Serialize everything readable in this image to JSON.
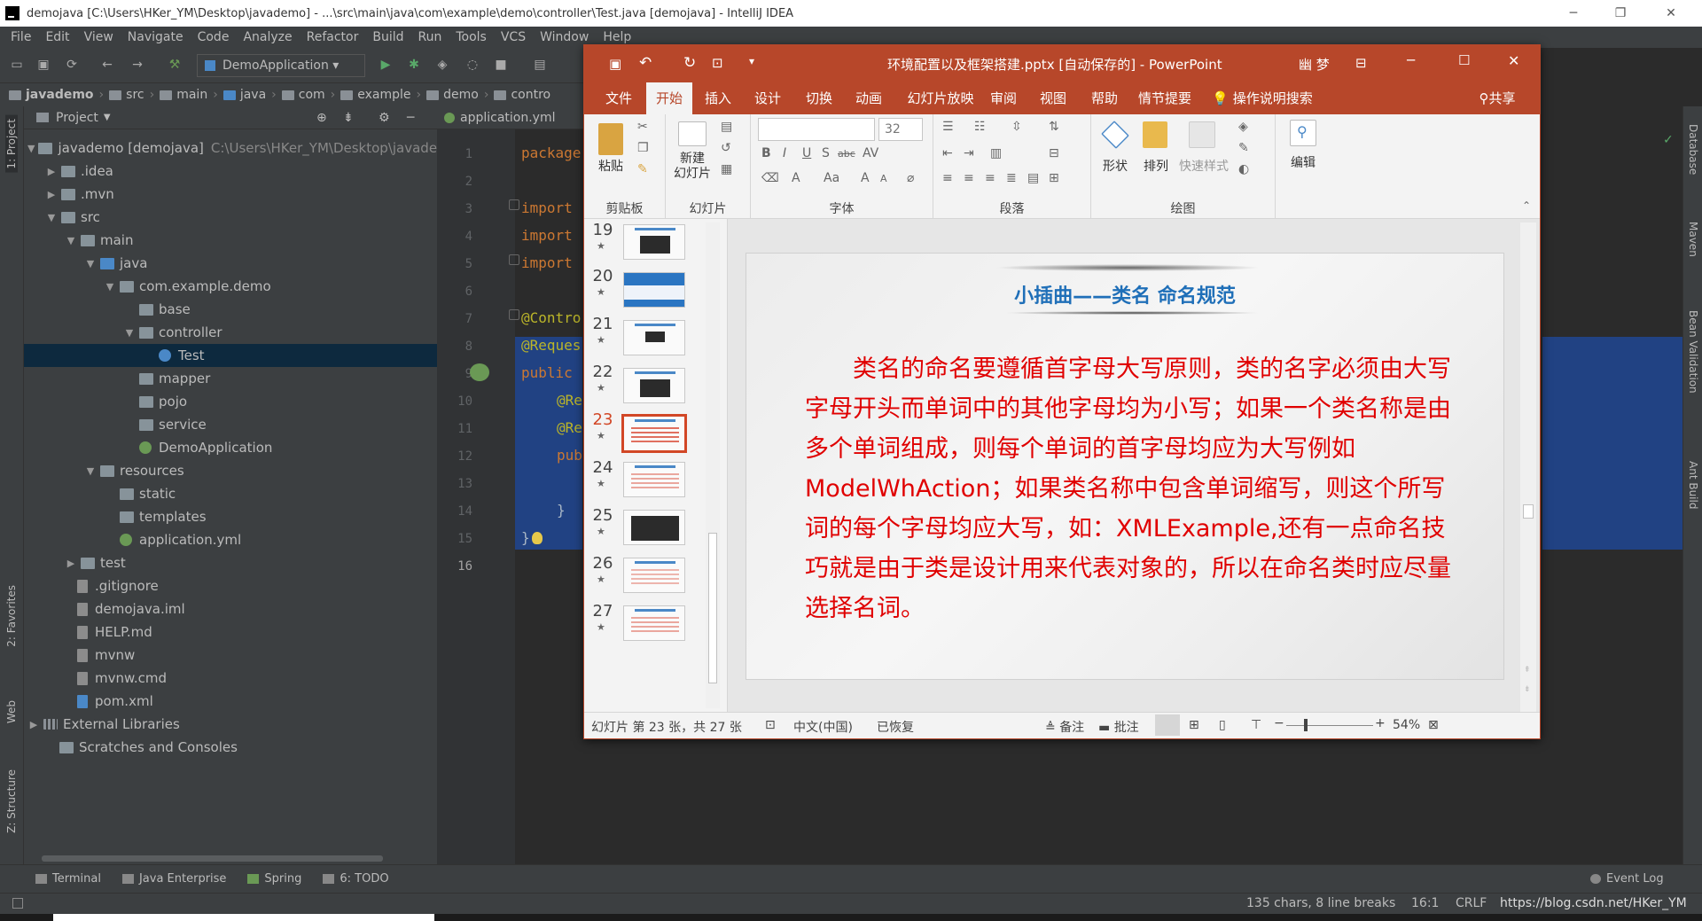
{
  "ide": {
    "title": "demojava [C:\\Users\\HKer_YM\\Desktop\\javademo] - ...\\src\\main\\java\\com\\example\\demo\\controller\\Test.java [demojava] - IntelliJ IDEA",
    "menu": [
      "File",
      "Edit",
      "View",
      "Navigate",
      "Code",
      "Analyze",
      "Refactor",
      "Build",
      "Run",
      "Tools",
      "VCS",
      "Window",
      "Help"
    ],
    "run_config": "DemoApplication",
    "breadcrumbs": [
      "javademo",
      "src",
      "main",
      "java",
      "com",
      "example",
      "demo",
      "contro"
    ],
    "project_label": "Project",
    "editor_tab": "application.yml",
    "tree": [
      {
        "label": "javademo [demojava]",
        "path": "C:\\Users\\HKer_YM\\Desktop\\javade"
      },
      {
        "label": ".idea"
      },
      {
        "label": ".mvn"
      },
      {
        "label": "src"
      },
      {
        "label": "main"
      },
      {
        "label": "java"
      },
      {
        "label": "com.example.demo"
      },
      {
        "label": "base"
      },
      {
        "label": "controller"
      },
      {
        "label": "Test"
      },
      {
        "label": "mapper"
      },
      {
        "label": "pojo"
      },
      {
        "label": "service"
      },
      {
        "label": "DemoApplication"
      },
      {
        "label": "resources"
      },
      {
        "label": "static"
      },
      {
        "label": "templates"
      },
      {
        "label": "application.yml"
      },
      {
        "label": "test"
      },
      {
        "label": ".gitignore"
      },
      {
        "label": "demojava.iml"
      },
      {
        "label": "HELP.md"
      },
      {
        "label": "mvnw"
      },
      {
        "label": "mvnw.cmd"
      },
      {
        "label": "pom.xml"
      },
      {
        "label": "External Libraries"
      },
      {
        "label": "Scratches and Consoles"
      }
    ],
    "line_numbers": [
      "1",
      "2",
      "3",
      "4",
      "5",
      "6",
      "7",
      "8",
      "9",
      "10",
      "11",
      "12",
      "13",
      "14",
      "15",
      "16"
    ],
    "code": [
      "package",
      "import",
      "import",
      "import",
      "@Contro",
      "@Reques",
      "public",
      "@Re",
      "@Re",
      "pub",
      "}",
      "}"
    ],
    "left_stripe": [
      "1: Project",
      "2: Favorites",
      "Web",
      "Z: Structure"
    ],
    "right_stripe": [
      "Database",
      "Maven",
      "Bean Validation",
      "Ant Build"
    ],
    "bottom_tools": [
      "Terminal",
      "Java Enterprise",
      "Spring",
      "6: TODO"
    ],
    "event_log": "Event Log",
    "status": {
      "chars": "135 chars, 8 line breaks",
      "pos": "16:1",
      "crlf": "CRLF",
      "overlay": "https://blog.csdn.net/HKer_YM"
    }
  },
  "ppt": {
    "title": "环境配置以及框架搭建.pptx [自动保存的]  -  PowerPoint",
    "user": "幽 梦",
    "tabs": [
      "文件",
      "开始",
      "插入",
      "设计",
      "切换",
      "动画",
      "幻灯片放映",
      "审阅",
      "视图",
      "帮助",
      "情节提要"
    ],
    "search": "操作说明搜索",
    "share": "共享",
    "ribbon": {
      "paste": "粘贴",
      "clipboard": "剪贴板",
      "new_slide": "新建\n幻灯片",
      "new_slide_a": "新建",
      "new_slide_b": "幻灯片",
      "slides_group": "幻灯片",
      "font_size": "32",
      "font_group": "字体",
      "para_group": "段落",
      "shape": "形状",
      "arrange": "排列",
      "quick_style": "快速样式",
      "draw_group": "绘图",
      "edit": "编辑"
    },
    "thumbs": [
      "19",
      "20",
      "21",
      "22",
      "23",
      "24",
      "25",
      "26",
      "27"
    ],
    "slide": {
      "title": "小插曲——类名 命名规范",
      "body": "类名的命名要遵循首字母大写原则，类的名字必须由大写字母开头而单词中的其他字母均为小写；如果一个类名称是由多个单词组成，则每个单词的首字母均应为大写例如ModelWhAction；如果类名称中包含单词缩写，则这个所写词的每个字母均应大写，如：XMLExample,还有一点命名技巧就是由于类是设计用来代表对象的，所以在命名类时应尽量选择名词。"
    },
    "status": {
      "slide_info": "幻灯片 第 23 张，共 27 张",
      "lang": "中文(中国)",
      "restored": "已恢复",
      "notes": "备注",
      "comments": "批注",
      "zoom": "54%"
    }
  }
}
